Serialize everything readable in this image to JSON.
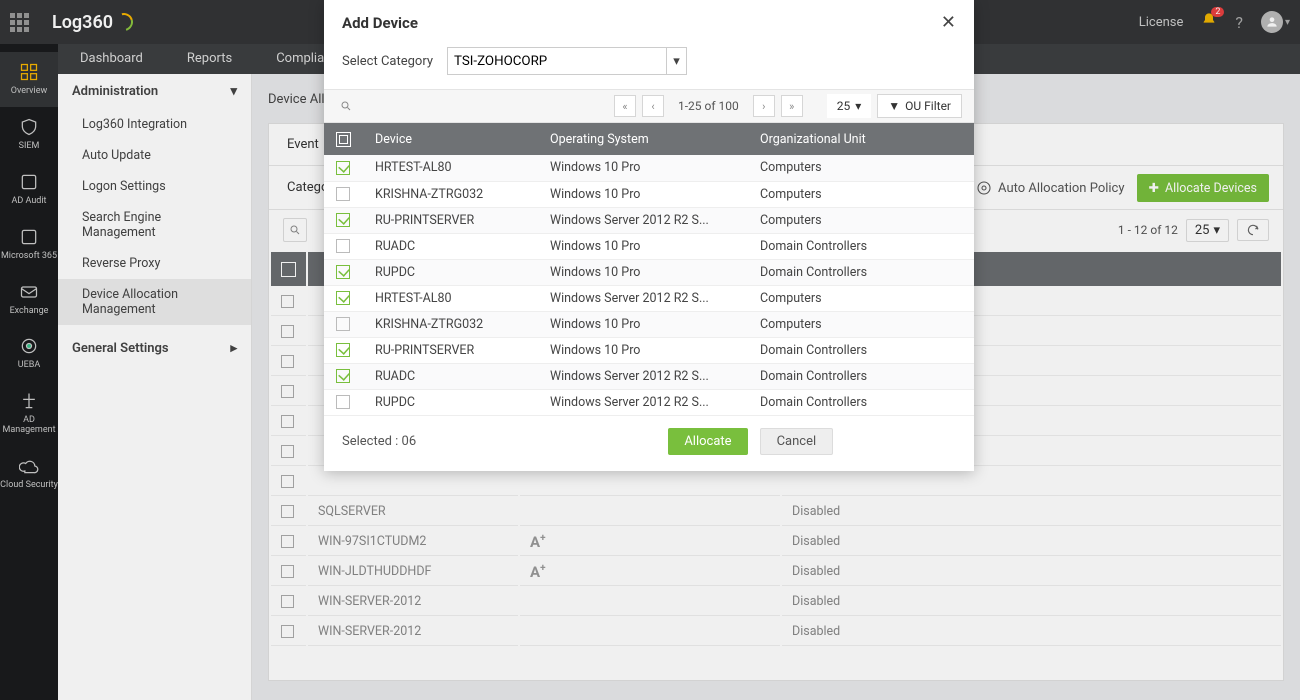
{
  "header": {
    "product": "Log360",
    "license": "License",
    "notif_count": "2",
    "help": "?"
  },
  "nav2": [
    "Dashboard",
    "Reports",
    "Compliance"
  ],
  "rail": [
    {
      "label": "Overview",
      "icon": "overview",
      "active": true
    },
    {
      "label": "SIEM",
      "icon": "shield"
    },
    {
      "label": "AD Audit",
      "icon": "adaudit"
    },
    {
      "label": "Microsoft 365",
      "icon": "m365"
    },
    {
      "label": "Exchange",
      "icon": "exchange"
    },
    {
      "label": "UEBA",
      "icon": "ueba"
    },
    {
      "label": "AD Management",
      "icon": "adman"
    },
    {
      "label": "Cloud Security",
      "icon": "cloud"
    }
  ],
  "admin": {
    "head": "Administration",
    "items": [
      "Log360 Integration",
      "Auto Update",
      "Logon Settings",
      "Search Engine Management",
      "Reverse Proxy",
      "Device Allocation Management"
    ],
    "selected_index": 5,
    "general": "General Settings"
  },
  "main": {
    "breadcrumb": "Device Allo",
    "tab": "Event",
    "category_label": "Catego",
    "auto_policy": "Auto Allocation Policy",
    "allocate_btn": "Allocate Devices",
    "pager": "1 - 12 of 12",
    "page_size": "25",
    "bg_rows": [
      {
        "name": "",
        "atype": "",
        "status": ""
      },
      {
        "name": "",
        "atype": "",
        "status": ""
      },
      {
        "name": "",
        "atype": "",
        "status": ""
      },
      {
        "name": "",
        "atype": "",
        "status": ""
      },
      {
        "name": "",
        "atype": "",
        "status": ""
      },
      {
        "name": "",
        "atype": "",
        "status": ""
      },
      {
        "name": "",
        "atype": "",
        "status": ""
      },
      {
        "name": "SQLSERVER",
        "atype": "",
        "status": "Disabled"
      },
      {
        "name": "WIN-97SI1CTUDM2",
        "atype": "A+",
        "status": "Disabled"
      },
      {
        "name": "WIN-JLDTHUDDHDF",
        "atype": "A+",
        "status": "Disabled"
      },
      {
        "name": "WIN-SERVER-2012",
        "atype": "",
        "status": "Disabled"
      },
      {
        "name": "WIN-SERVER-2012",
        "atype": "",
        "status": "Disabled"
      }
    ]
  },
  "modal": {
    "title": "Add Device",
    "select_cat_label": "Select Category",
    "select_cat_value": "TSI-ZOHOCORP",
    "pager_text": "1-25 of 100",
    "page_size": "25",
    "ou_filter": "OU Filter",
    "cols": {
      "c1": "Device",
      "c2": "Operating System",
      "c3": "Organizational Unit"
    },
    "rows": [
      {
        "chk": true,
        "device": "HRTEST-AL80",
        "os": "Windows 10 Pro",
        "ou": "Computers"
      },
      {
        "chk": false,
        "device": "KRISHNA-ZTRG032",
        "os": "Windows 10 Pro",
        "ou": "Computers"
      },
      {
        "chk": true,
        "device": "RU-PRINTSERVER",
        "os": "Windows Server 2012 R2 S...",
        "ou": "Computers"
      },
      {
        "chk": false,
        "device": "RUADC",
        "os": "Windows 10 Pro",
        "ou": "Domain Controllers"
      },
      {
        "chk": true,
        "device": "RUPDC",
        "os": "Windows 10 Pro",
        "ou": "Domain Controllers"
      },
      {
        "chk": true,
        "device": "HRTEST-AL80",
        "os": "Windows Server 2012 R2 S...",
        "ou": "Computers"
      },
      {
        "chk": false,
        "device": "KRISHNA-ZTRG032",
        "os": "Windows 10 Pro",
        "ou": "Computers"
      },
      {
        "chk": true,
        "device": "RU-PRINTSERVER",
        "os": "Windows 10 Pro",
        "ou": "Domain Controllers"
      },
      {
        "chk": true,
        "device": "RUADC",
        "os": "Windows Server 2012 R2 S...",
        "ou": "Domain Controllers"
      },
      {
        "chk": false,
        "device": "RUPDC",
        "os": "Windows Server 2012 R2 S...",
        "ou": "Domain Controllers"
      }
    ],
    "selected_text": "Selected : 06",
    "allocate": "Allocate",
    "cancel": "Cancel"
  }
}
